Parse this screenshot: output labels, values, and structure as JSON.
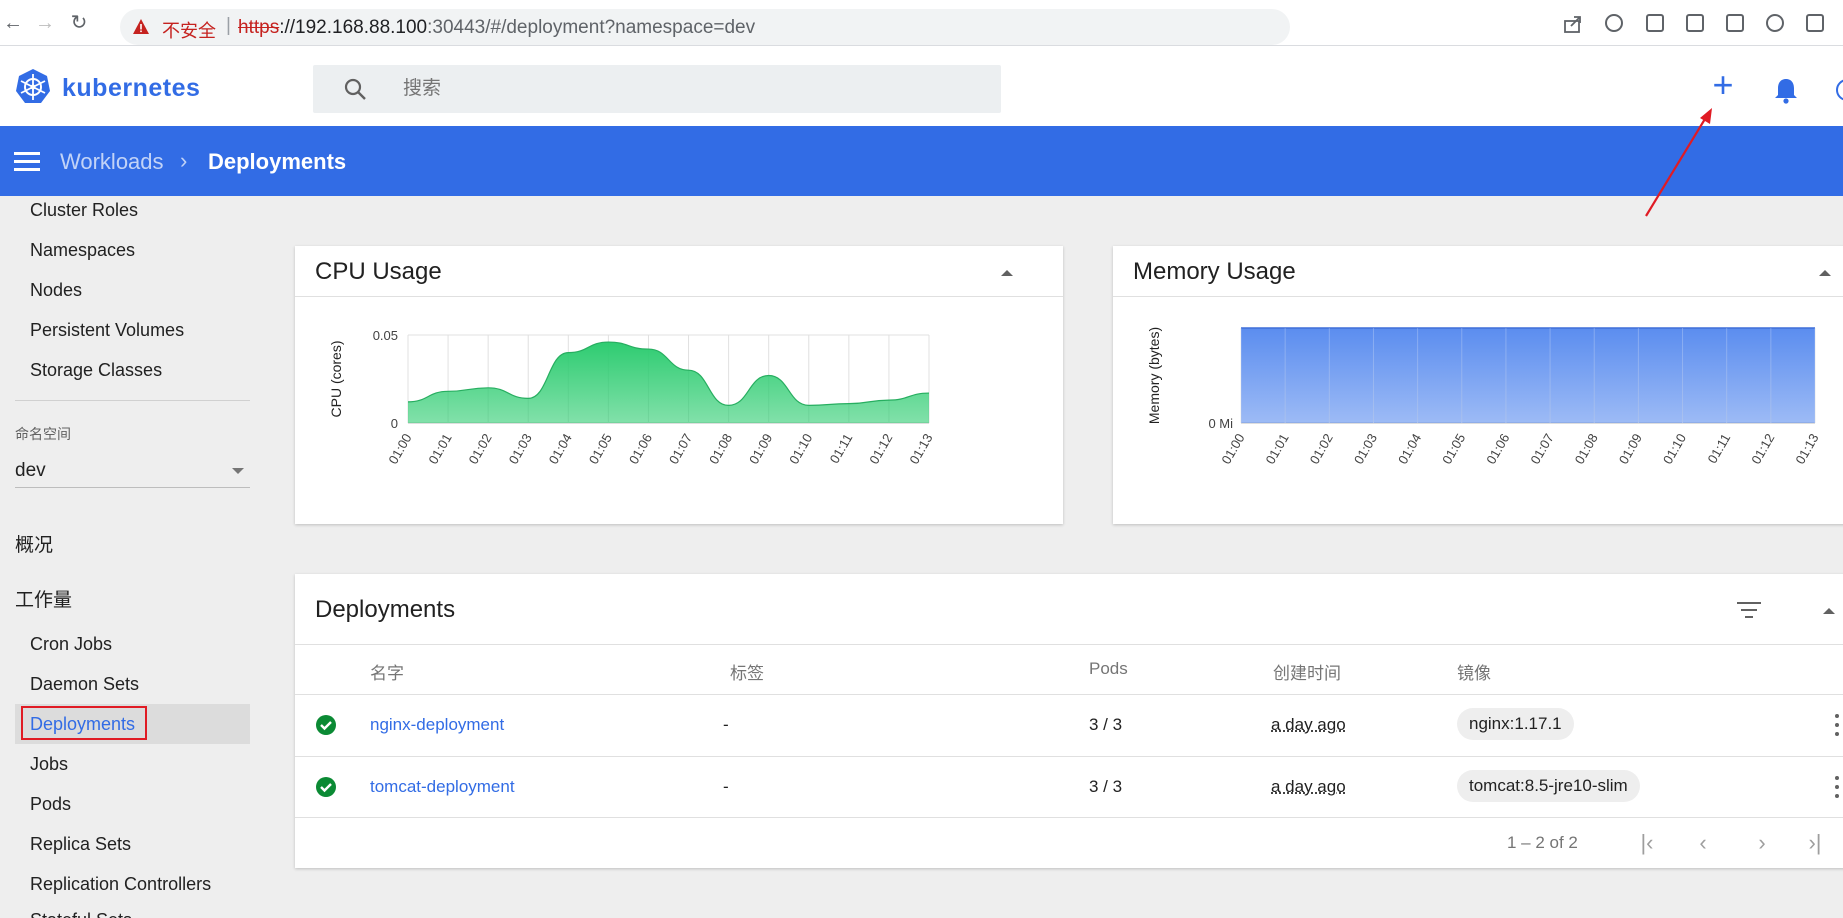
{
  "browser": {
    "back_icon": "arrow-left-icon",
    "forward_icon": "arrow-right-icon",
    "reload_icon": "reload-icon",
    "insecure_label": "不安全",
    "separator": "|",
    "url_scheme": "https",
    "url_rest_host": "://192.168.88.100",
    "url_rest_path": ":30443/#/deployment?namespace=dev"
  },
  "header": {
    "logo_text": "kubernetes",
    "search_placeholder": "搜索",
    "plus_label": "+"
  },
  "toolbar": {
    "breadcrumb_parent": "Workloads",
    "breadcrumb_separator": "›",
    "breadcrumb_current": "Deployments"
  },
  "sidebar": {
    "cluster_items": [
      "Cluster Roles",
      "Namespaces",
      "Nodes",
      "Persistent Volumes",
      "Storage Classes"
    ],
    "namespace_label": "命名空间",
    "namespace_value": "dev",
    "overview_label": "概况",
    "workloads_label": "工作量",
    "workload_items": [
      "Cron Jobs",
      "Daemon Sets",
      "Deployments",
      "Jobs",
      "Pods",
      "Replica Sets",
      "Replication Controllers",
      "Stateful Sets"
    ],
    "active_item": "Deployments"
  },
  "cpu_card": {
    "title": "CPU Usage"
  },
  "memory_card": {
    "title": "Memory Usage"
  },
  "chart_data": [
    {
      "type": "area",
      "title": "CPU Usage",
      "ylabel": "CPU (cores)",
      "x": [
        "01:00",
        "01:01",
        "01:02",
        "01:03",
        "01:04",
        "01:05",
        "01:06",
        "01:07",
        "01:08",
        "01:09",
        "01:10",
        "01:11",
        "01:12",
        "01:13"
      ],
      "values": [
        0.012,
        0.018,
        0.02,
        0.014,
        0.04,
        0.046,
        0.042,
        0.03,
        0.01,
        0.027,
        0.01,
        0.011,
        0.013,
        0.017
      ],
      "ylim": [
        0,
        0.05
      ],
      "yticks": [
        "0",
        "0.05"
      ],
      "grid": true,
      "color": "#2ecc71"
    },
    {
      "type": "area",
      "title": "Memory Usage",
      "ylabel": "Memory (bytes)",
      "x": [
        "01:00",
        "01:01",
        "01:02",
        "01:03",
        "01:04",
        "01:05",
        "01:06",
        "01:07",
        "01:08",
        "01:09",
        "01:10",
        "01:11",
        "01:12",
        "01:13"
      ],
      "yticks": [
        "0 Mi"
      ],
      "grid": true,
      "color": "#5b8def"
    }
  ],
  "deployments": {
    "title": "Deployments",
    "columns": [
      "名字",
      "标签",
      "Pods",
      "创建时间",
      "镜像"
    ],
    "rows": [
      {
        "name": "nginx-deployment",
        "labels": "-",
        "pods": "3 / 3",
        "created": "a day ago",
        "image": "nginx:1.17.1"
      },
      {
        "name": "tomcat-deployment",
        "labels": "-",
        "pods": "3 / 3",
        "created": "a day ago",
        "image": "tomcat:8.5-jre10-slim"
      }
    ],
    "pagination": "1 – 2 of 2"
  },
  "colors": {
    "brand": "#326ce5",
    "status_ok": "#0b8a34",
    "annotation": "#e01b24"
  }
}
